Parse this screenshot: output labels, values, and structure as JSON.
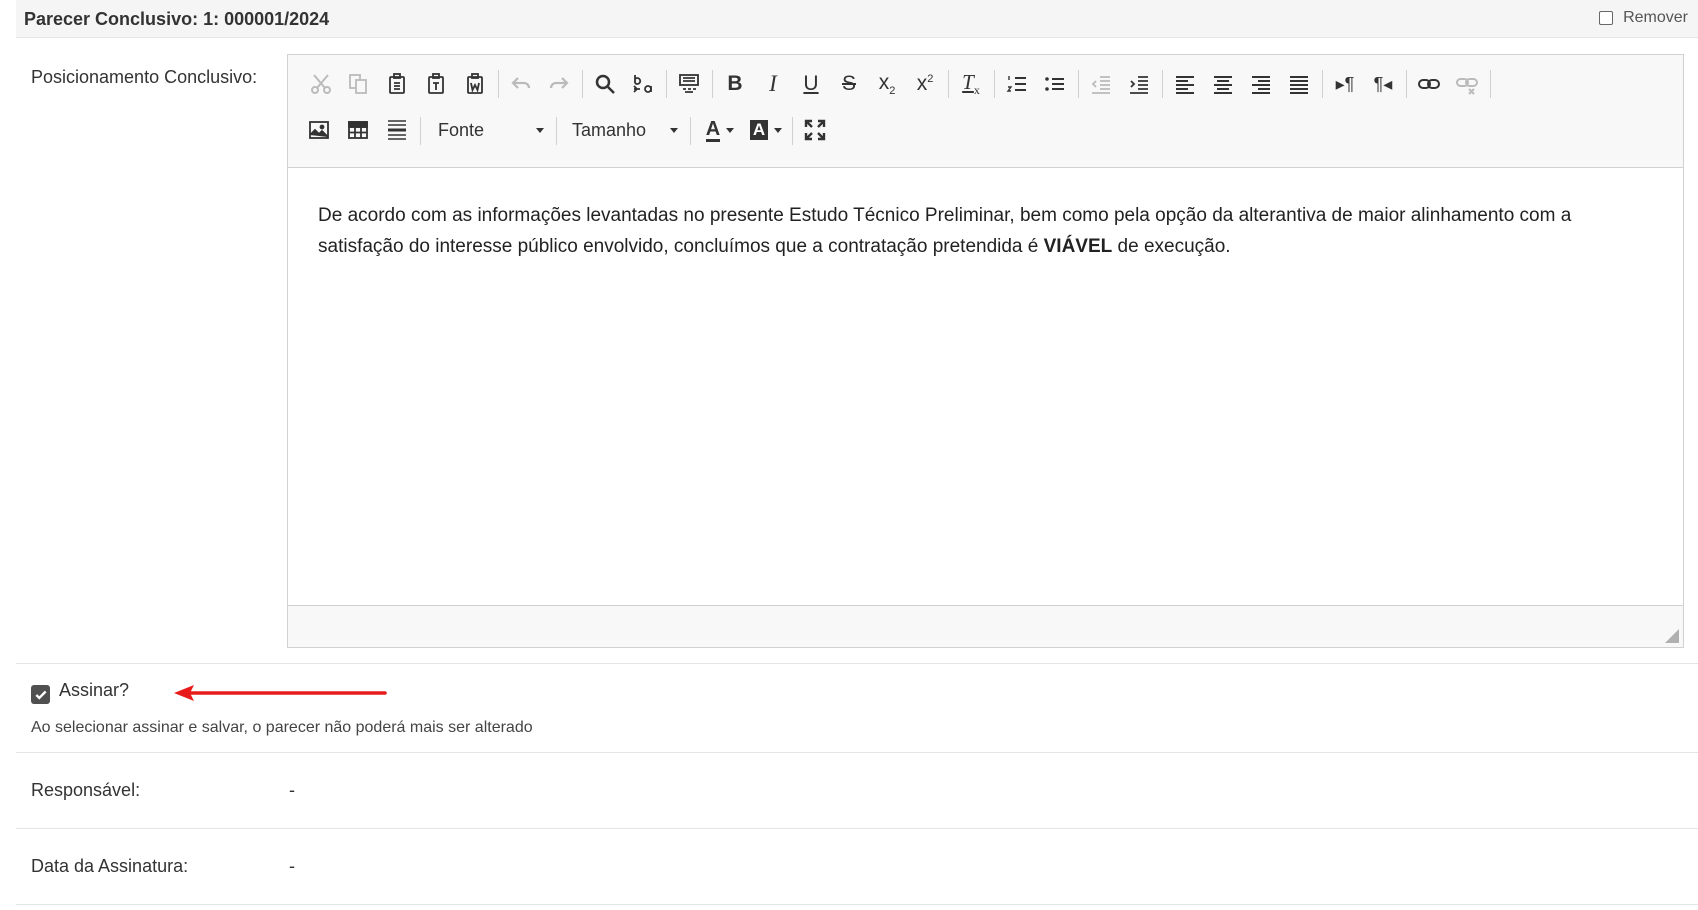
{
  "header": {
    "title": "Parecer Conclusivo: 1: 000001/2024",
    "remove_label": "Remover"
  },
  "form": {
    "position_label": "Posicionamento Conclusivo:",
    "sign_label": "Assinar?",
    "sign_checked": true,
    "sign_note": "Ao selecionar assinar e salvar, o parecer não poderá mais ser alterado",
    "responsible_label": "Responsável:",
    "responsible_value": "-",
    "date_label": "Data da Assinatura:",
    "date_value": "-"
  },
  "editor": {
    "font_combo": "Fonte",
    "size_combo": "Tamanho",
    "content_part1": "De acordo com as informações levantadas no presente Estudo Técnico Preliminar, bem como pela opção da alterantiva de maior alinhamento com a satisfação do interesse público envolvido, concluímos que a contratação pretendida é ",
    "content_bold": "VIÁVEL",
    "content_part2": " de execução."
  },
  "colors": {
    "arrow": "#e81b1b",
    "toolbar_bg": "#f8f8f8",
    "border": "#d1d1d1"
  }
}
